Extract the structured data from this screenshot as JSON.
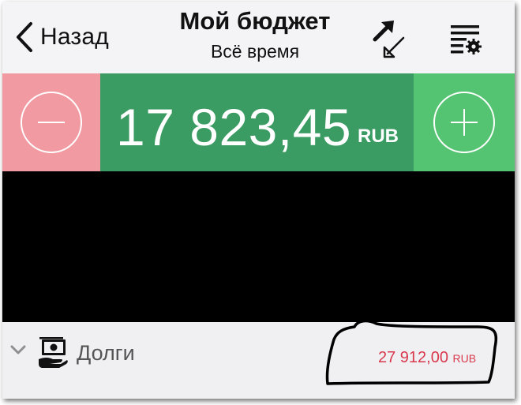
{
  "navbar": {
    "back_label": "Назад",
    "title": "Мой бюджет",
    "subtitle": "Всё время",
    "transfer_icon": "transfer-arrows-icon",
    "settings_icon": "list-settings-icon"
  },
  "balance": {
    "value": "17 823,45",
    "currency": "RUB",
    "minus_icon": "minus-circle-icon",
    "plus_icon": "plus-circle-icon"
  },
  "debts": {
    "label": "Долги",
    "amount": "27 912,00",
    "currency": "RUB",
    "icon": "money-hand-icon"
  },
  "colors": {
    "expense": "#f29aa1",
    "balance": "#3a9b63",
    "income": "#55c472",
    "debt_amount": "#d9394d"
  }
}
